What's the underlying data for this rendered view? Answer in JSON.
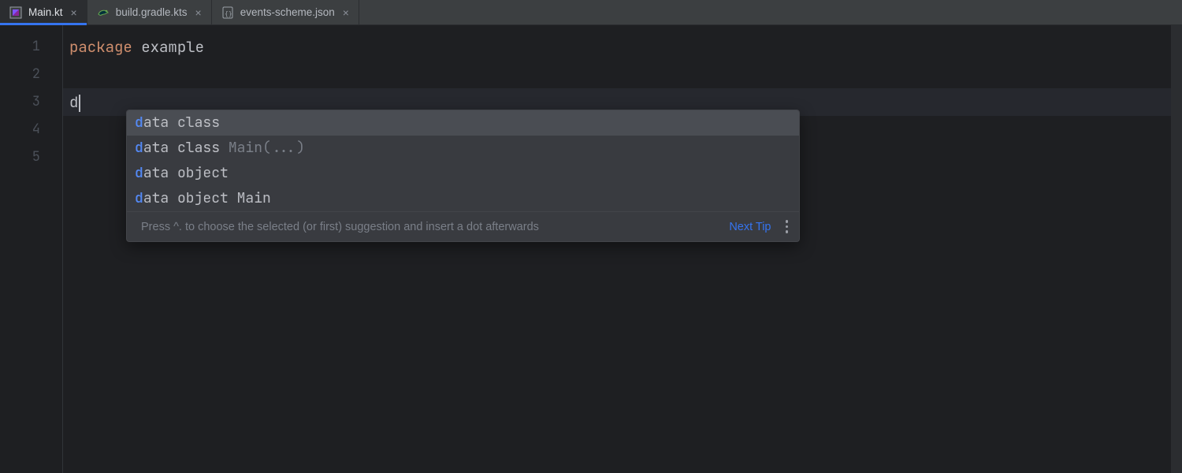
{
  "tabs": [
    {
      "label": "Main.kt",
      "icon": "kotlin-file-icon",
      "active": true
    },
    {
      "label": "build.gradle.kts",
      "icon": "gradle-kotlin-icon",
      "active": false
    },
    {
      "label": "events-scheme.json",
      "icon": "json-file-icon",
      "active": false
    }
  ],
  "gutter": {
    "lines": [
      "1",
      "2",
      "3",
      "4",
      "5"
    ]
  },
  "code": {
    "line1_keyword": "package",
    "line1_pkg": " example",
    "line3_typed": "d"
  },
  "completion": {
    "items": [
      {
        "match": "d",
        "rest": "ata class",
        "hint": ""
      },
      {
        "match": "d",
        "rest": "ata class ",
        "hint": "Main(...)"
      },
      {
        "match": "d",
        "rest": "ata object",
        "hint": ""
      },
      {
        "match": "d",
        "rest": "ata object Main",
        "hint": ""
      }
    ],
    "footer_hint": "Press ^. to choose the selected (or first) suggestion and insert a dot afterwards",
    "footer_link": "Next Tip"
  }
}
